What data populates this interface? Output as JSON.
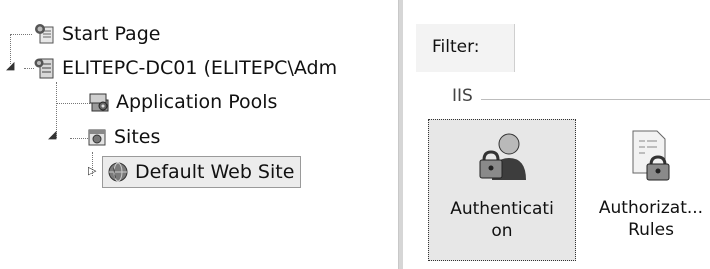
{
  "tree": {
    "items": [
      {
        "label": "Start Page",
        "icon": "start-page-icon",
        "expander": ""
      },
      {
        "label": "ELITEPC-DC01 (ELITEPC\\Adm",
        "icon": "server-icon",
        "expander": "◢"
      },
      {
        "label": "Application Pools",
        "icon": "application-pools-icon",
        "expander": ""
      },
      {
        "label": "Sites",
        "icon": "sites-folder-icon",
        "expander": "◢"
      },
      {
        "label": "Default Web Site",
        "icon": "globe-icon",
        "expander": "▷",
        "selected": true
      }
    ]
  },
  "features": {
    "filter_label": "Filter:",
    "group_label": "IIS",
    "tiles": [
      {
        "label": "Authentication",
        "line1": "Authenticati",
        "line2": "on",
        "icon": "authentication-icon",
        "selected": true
      },
      {
        "label": "Authorization Rules",
        "line1": "Authorizat...",
        "line2": "Rules",
        "icon": "authorization-rules-icon",
        "selected": false
      }
    ]
  }
}
